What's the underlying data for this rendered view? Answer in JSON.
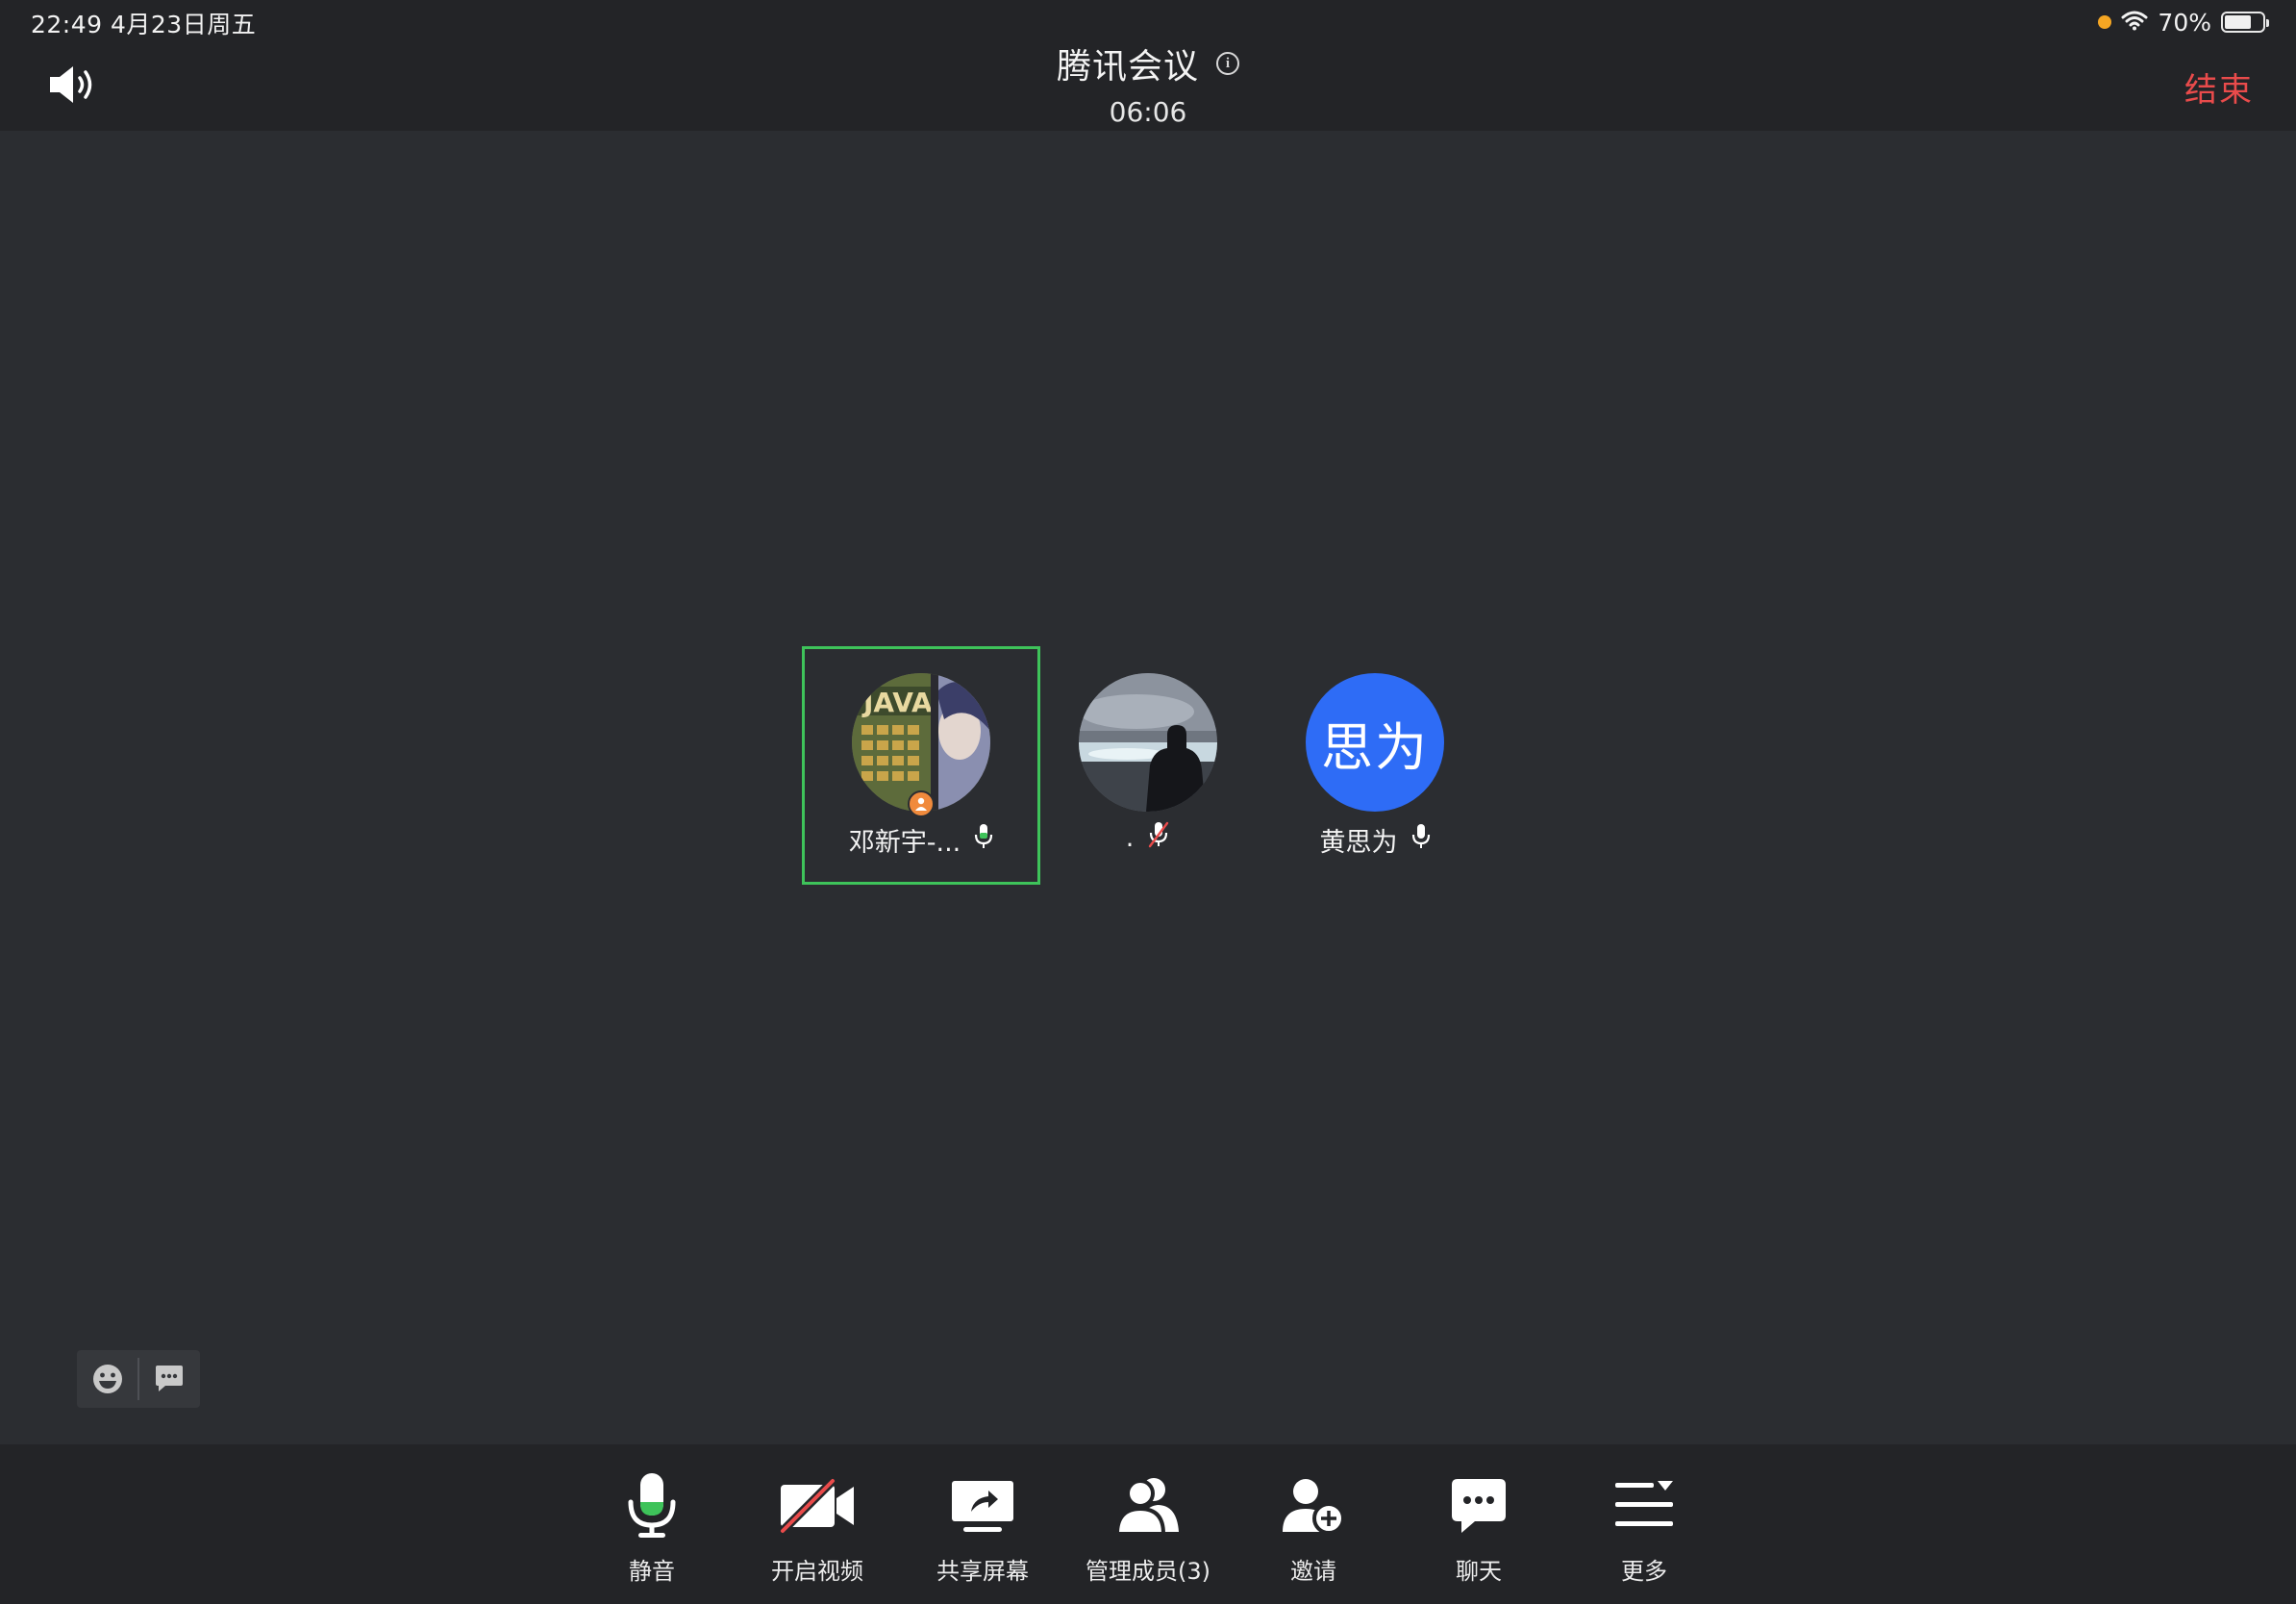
{
  "status_bar": {
    "time_date": "22:49   4月23日周五",
    "battery": "70%",
    "battery_level": 0.7
  },
  "header": {
    "title": "腾讯会议",
    "timer": "06:06",
    "end_label": "结束"
  },
  "participants": [
    {
      "name": "邓新宇-...",
      "avatar_type": "photo",
      "is_host": true,
      "mic": "on",
      "speaking": true
    },
    {
      "name": ".",
      "avatar_type": "photo",
      "is_host": false,
      "mic": "muted",
      "speaking": false
    },
    {
      "name": "黄思为",
      "avatar_type": "text",
      "avatar_text": "思为",
      "is_host": false,
      "mic": "on",
      "speaking": false
    }
  ],
  "colors": {
    "background": "#2b2d31",
    "bar": "#232427",
    "accent_green": "#3ec35a",
    "end_red": "#e94b4b",
    "avatar_blue": "#2e6cf6",
    "host_orange": "#f08a3c"
  },
  "toolbar": {
    "items": [
      {
        "label": "静音",
        "icon": "microphone-icon"
      },
      {
        "label": "开启视频",
        "icon": "video-off-icon"
      },
      {
        "label": "共享屏幕",
        "icon": "share-screen-icon"
      },
      {
        "label": "管理成员(3)",
        "icon": "members-icon"
      },
      {
        "label": "邀请",
        "icon": "invite-icon"
      },
      {
        "label": "聊天",
        "icon": "chat-icon"
      },
      {
        "label": "更多",
        "icon": "more-icon"
      }
    ]
  },
  "floating_tools": [
    {
      "icon": "emoji-icon"
    },
    {
      "icon": "danmaku-icon"
    }
  ]
}
